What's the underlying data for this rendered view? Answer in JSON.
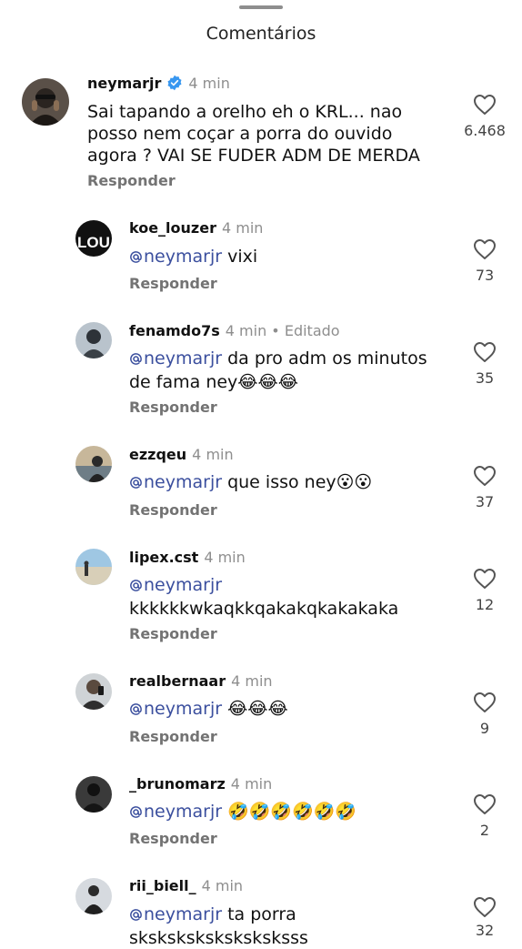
{
  "header": {
    "title": "Comentários"
  },
  "comments": [
    {
      "username": "neymarjr",
      "time": "4 min",
      "verified": true,
      "lines": [
        "Sai tapando a orelho eh o KRL... nao",
        "posso nem coçar a porra do ouvido",
        "agora ? VAI SE FUDER ADM DE MERDA"
      ],
      "reply_label": "Responder",
      "likes": "6.468"
    },
    {
      "username": "koe_louzer",
      "time": "4 min",
      "mention": "neymarjr",
      "text": "vixi",
      "reply_label": "Responder",
      "likes": "73",
      "avatar_text": "LOU"
    },
    {
      "username": "fenamdo7s",
      "time": "4 min",
      "edited": "Editado",
      "mention": "neymarjr",
      "text": "da pro adm os minutos",
      "line2": "de fama ney😂😂😂",
      "reply_label": "Responder",
      "likes": "35"
    },
    {
      "username": "ezzqeu",
      "time": "4 min",
      "mention": "neymarjr",
      "text": "que isso ney😮😮",
      "reply_label": "Responder",
      "likes": "37"
    },
    {
      "username": "lipex.cst",
      "time": "4 min",
      "mention": "neymarjr",
      "text": "",
      "line2": "kkkkkkwkaqkkqakakqkakakaka",
      "reply_label": "Responder",
      "likes": "12"
    },
    {
      "username": "realbernaar",
      "time": "4 min",
      "mention": "neymarjr",
      "text": "😂😂😂",
      "reply_label": "Responder",
      "likes": "9"
    },
    {
      "username": "_brunomarz",
      "time": "4 min",
      "mention": "neymarjr",
      "text": "🤣🤣🤣🤣🤣🤣",
      "reply_label": "Responder",
      "likes": "2"
    },
    {
      "username": "rii_biell_",
      "time": "4 min",
      "mention": "neymarjr",
      "text": "ta porra",
      "line2": "sksksksksksksksksss",
      "likes": "32"
    }
  ],
  "colors": {
    "mention": "#3b4f9e",
    "verified": "#3897f0",
    "muted": "#8e8e8e"
  },
  "icons": {
    "like": "heart-outline-icon",
    "verified": "verified-badge-icon",
    "mention": "threads-at-icon"
  }
}
